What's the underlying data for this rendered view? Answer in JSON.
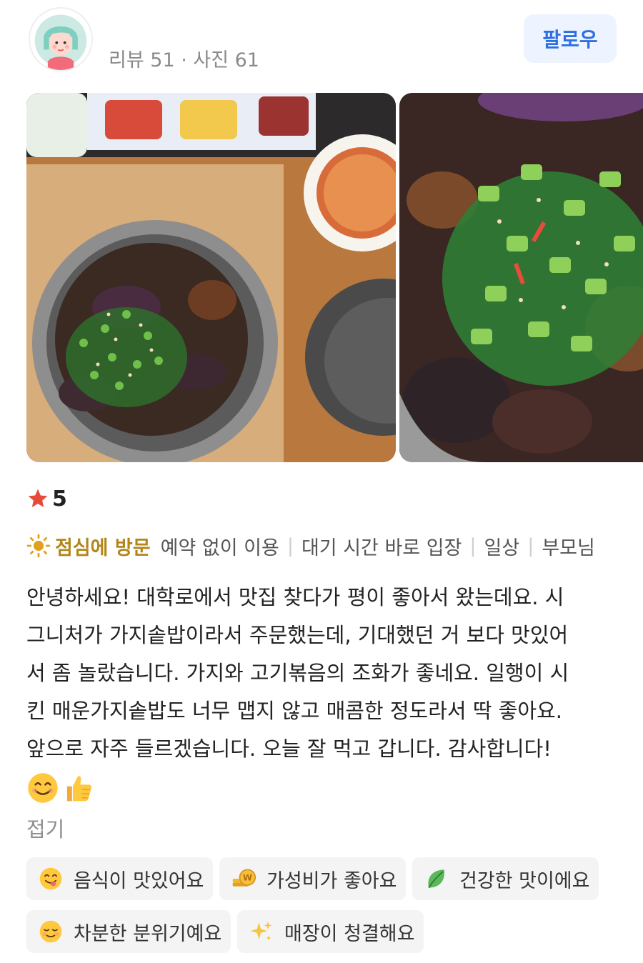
{
  "profile": {
    "username": "",
    "meta": "리뷰 51 · 사진 61",
    "follow_label": "팔로우"
  },
  "photos": [
    {
      "alt": "가지솥밥 정식"
    },
    {
      "alt": "가지솥밥 클로즈업"
    }
  ],
  "rating": {
    "value": "5",
    "color": "#e84a3a"
  },
  "visit": {
    "time_label": "점심에 방문",
    "tags": [
      "예약 없이 이용",
      "대기 시간 바로 입장",
      "일상",
      "부모님"
    ],
    "accent": "#b3861a"
  },
  "review": {
    "lines": [
      "안녕하세요! 대학로에서 맛집 찾다가 평이 좋아서 왔는데요. 시",
      "그니처가 가지솥밥이라서 주문했는데, 기대했던 거 보다 맛있어",
      "서 좀 놀랐습니다. 가지와 고기볶음의 조화가 좋네요. 일행이 시",
      "킨 매운가지솥밥도 너무 맵지 않고 매콤한 정도라서 딱 좋아요.",
      "앞으로 자주 들르겠습니다. 오늘 잘 먹고 갑니다. 감사합니다!"
    ],
    "emojis": [
      "smiling-face-icon",
      "thumbs-up-icon"
    ],
    "fold_label": "접기"
  },
  "keywords": [
    {
      "label": "음식이 맛있어요",
      "icon": "yum-face-icon"
    },
    {
      "label": "가성비가 좋아요",
      "icon": "coin-icon"
    },
    {
      "label": "건강한 맛이에요",
      "icon": "leaf-icon"
    },
    {
      "label": "차분한 분위기예요",
      "icon": "relieved-face-icon"
    },
    {
      "label": "매장이 청결해요",
      "icon": "sparkles-icon"
    }
  ],
  "colors": {
    "follow_bg": "#eef4ff",
    "follow_text": "#2f6fe4",
    "chip_bg": "#f4f4f4"
  }
}
